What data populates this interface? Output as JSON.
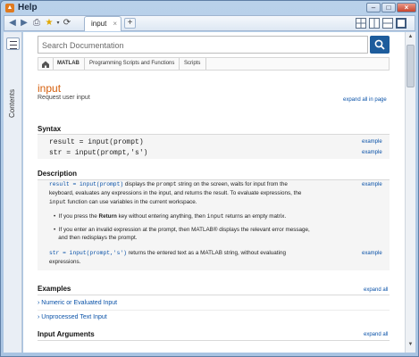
{
  "window": {
    "title": "Help",
    "app_icon": "matlab-logo",
    "controls": [
      "minimize",
      "maximize",
      "close"
    ]
  },
  "toolbar": {
    "icons": [
      "back-arrow-icon",
      "forward-arrow-icon",
      "print-icon",
      "star-icon",
      "refresh-icon"
    ],
    "tab_label": "input",
    "tab_close": "×",
    "add_tab": "+"
  },
  "sidebar": {
    "label": "Contents"
  },
  "search": {
    "placeholder": "Search Documentation"
  },
  "breadcrumb": {
    "items": [
      "MATLAB",
      "Programming Scripts and Functions",
      "Scripts"
    ]
  },
  "page": {
    "title": "input",
    "subtitle": "Request user input",
    "expand_all_page": "expand all in page"
  },
  "syntax": {
    "heading": "Syntax",
    "lines": [
      {
        "code": "result = input(prompt)",
        "link": "example"
      },
      {
        "code": "str = input(prompt,'s')",
        "link": "example"
      }
    ]
  },
  "description": {
    "heading": "Description",
    "example_link": "example",
    "para1_code": "result = input(prompt)",
    "para1_a": " displays the ",
    "para1_prompt": "prompt",
    "para1_b": " string on the screen, waits for input from the",
    "para1_line2": "keyboard, evaluates any expressions in the input, and returns the result. To evaluate expressions, the",
    "para1_input": "input",
    "para1_line3": " function can use variables in the current workspace.",
    "bullet1_a": "If you press the ",
    "bullet1_bold": "Return",
    "bullet1_b": " key without entering anything, then ",
    "bullet1_code": "input",
    "bullet1_c": " returns an empty matrix.",
    "bullet2_line1": "If you enter an invalid expression at the prompt, then MATLAB® displays the relevant error message,",
    "bullet2_line2": "and then redisplays the prompt.",
    "para2_code": "str = input(prompt,'s')",
    "para2_text": " returns the entered text as a MATLAB string, without evaluating",
    "para2_line2": "expressions.",
    "example_link2": "example"
  },
  "examples": {
    "heading": "Examples",
    "expand_all": "expand all",
    "items": [
      "Numeric or Evaluated Input",
      "Unprocessed Text Input"
    ]
  },
  "input_arguments": {
    "heading": "Input Arguments",
    "expand_all": "expand all"
  },
  "colors": {
    "title_orange": "#d55e0b",
    "link_blue": "#0a52a8",
    "search_button": "#1d5c9c"
  }
}
